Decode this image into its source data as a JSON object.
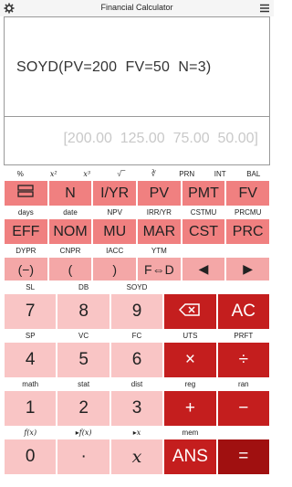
{
  "header": {
    "title": "Financial Calculator"
  },
  "display": {
    "expression": "SOYD(PV=200  FV=50  N=3)",
    "result": "[200.00  125.00  75.00  50.00]"
  },
  "rows": [
    {
      "labels": [
        "%",
        "x²",
        "x³",
        "√ ̅",
        "∛",
        "PRN",
        "INT",
        "BAL"
      ],
      "keys": [
        "",
        "N",
        "I/YR",
        "PV",
        "PMT",
        "FV"
      ]
    },
    {
      "labels": [
        "days",
        "date",
        "NPV",
        "IRR/YR",
        "CSTMU",
        "PRCMU"
      ],
      "keys": [
        "EFF",
        "NOM",
        "MU",
        "MAR",
        "CST",
        "PRC"
      ]
    },
    {
      "labels": [
        "DYPR",
        "CNPR",
        "IACC",
        "YTM",
        "",
        ""
      ],
      "keys": [
        "(−)",
        "(",
        ")",
        "F⇔D",
        "◀",
        "▶"
      ]
    },
    {
      "labels": [
        "SL",
        "DB",
        "SOYD",
        "",
        ""
      ],
      "keys": [
        "7",
        "8",
        "9",
        "⌫",
        "AC"
      ]
    },
    {
      "labels": [
        "SP",
        "VC",
        "FC",
        "UTS",
        "PRFT"
      ],
      "keys": [
        "4",
        "5",
        "6",
        "×",
        "÷"
      ]
    },
    {
      "labels": [
        "math",
        "stat",
        "dist",
        "reg",
        "ran"
      ],
      "keys": [
        "1",
        "2",
        "3",
        "+",
        "−"
      ]
    },
    {
      "labels": [
        "f(x)",
        "▸f(x)",
        "▸x",
        "mem",
        ""
      ],
      "keys": [
        "0",
        "·",
        "x",
        "ANS",
        "="
      ]
    }
  ]
}
